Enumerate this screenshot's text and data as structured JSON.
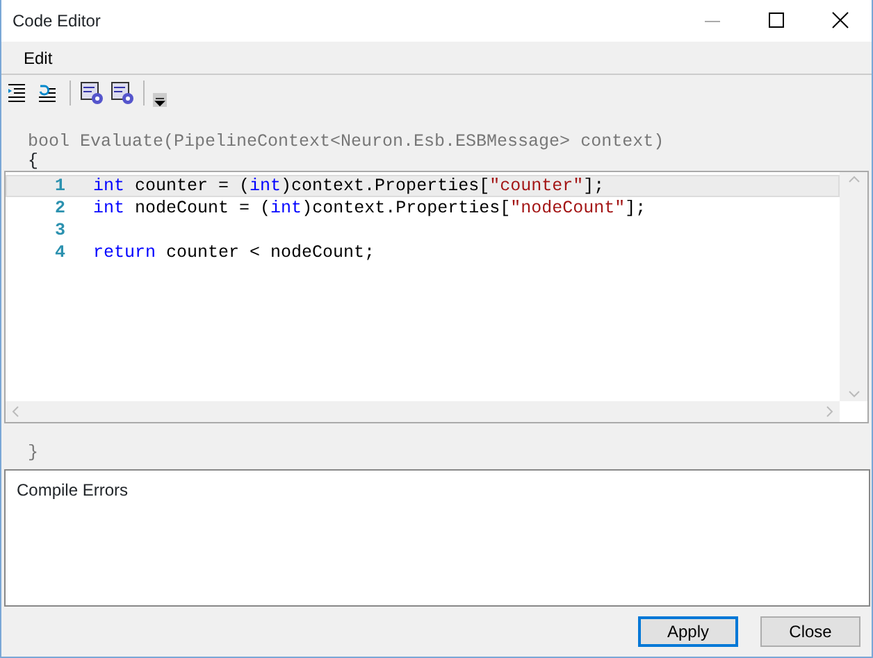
{
  "window": {
    "title": "Code Editor"
  },
  "menu": [
    "Edit"
  ],
  "toolbar": [
    {
      "kind": "indent"
    },
    {
      "kind": "outdent"
    },
    {
      "kind": "sep"
    },
    {
      "kind": "doc-gear"
    },
    {
      "kind": "doc-gear"
    },
    {
      "kind": "sep"
    },
    {
      "kind": "overflow"
    }
  ],
  "signature": "bool Evaluate(PipelineContext<Neuron.Esb.ESBMessage> context)",
  "open_brace": "{",
  "editor": {
    "lines": [
      {
        "number": "1",
        "current": true,
        "tokens": [
          {
            "text": "int",
            "kind": "keyword"
          },
          {
            "text": " counter = (",
            "kind": "plain"
          },
          {
            "text": "int",
            "kind": "keyword"
          },
          {
            "text": ")context.Properties[",
            "kind": "plain"
          },
          {
            "text": "\"counter\"",
            "kind": "string"
          },
          {
            "text": "];",
            "kind": "plain"
          }
        ]
      },
      {
        "number": "2",
        "current": false,
        "tokens": [
          {
            "text": "int",
            "kind": "keyword"
          },
          {
            "text": " nodeCount = (",
            "kind": "plain"
          },
          {
            "text": "int",
            "kind": "keyword"
          },
          {
            "text": ")context.Properties[",
            "kind": "plain"
          },
          {
            "text": "\"nodeCount\"",
            "kind": "string"
          },
          {
            "text": "];",
            "kind": "plain"
          }
        ]
      },
      {
        "number": "3",
        "current": false
      },
      {
        "number": "4",
        "current": false,
        "tokens": [
          {
            "text": "return",
            "kind": "keyword"
          },
          {
            "text": " counter < nodeCount;",
            "kind": "plain"
          }
        ]
      }
    ]
  },
  "close_brace": "}",
  "errors": {
    "label": "Compile Errors"
  },
  "buttons": [
    {
      "label": "Apply",
      "default": true
    },
    {
      "label": "Close",
      "default": false
    }
  ]
}
